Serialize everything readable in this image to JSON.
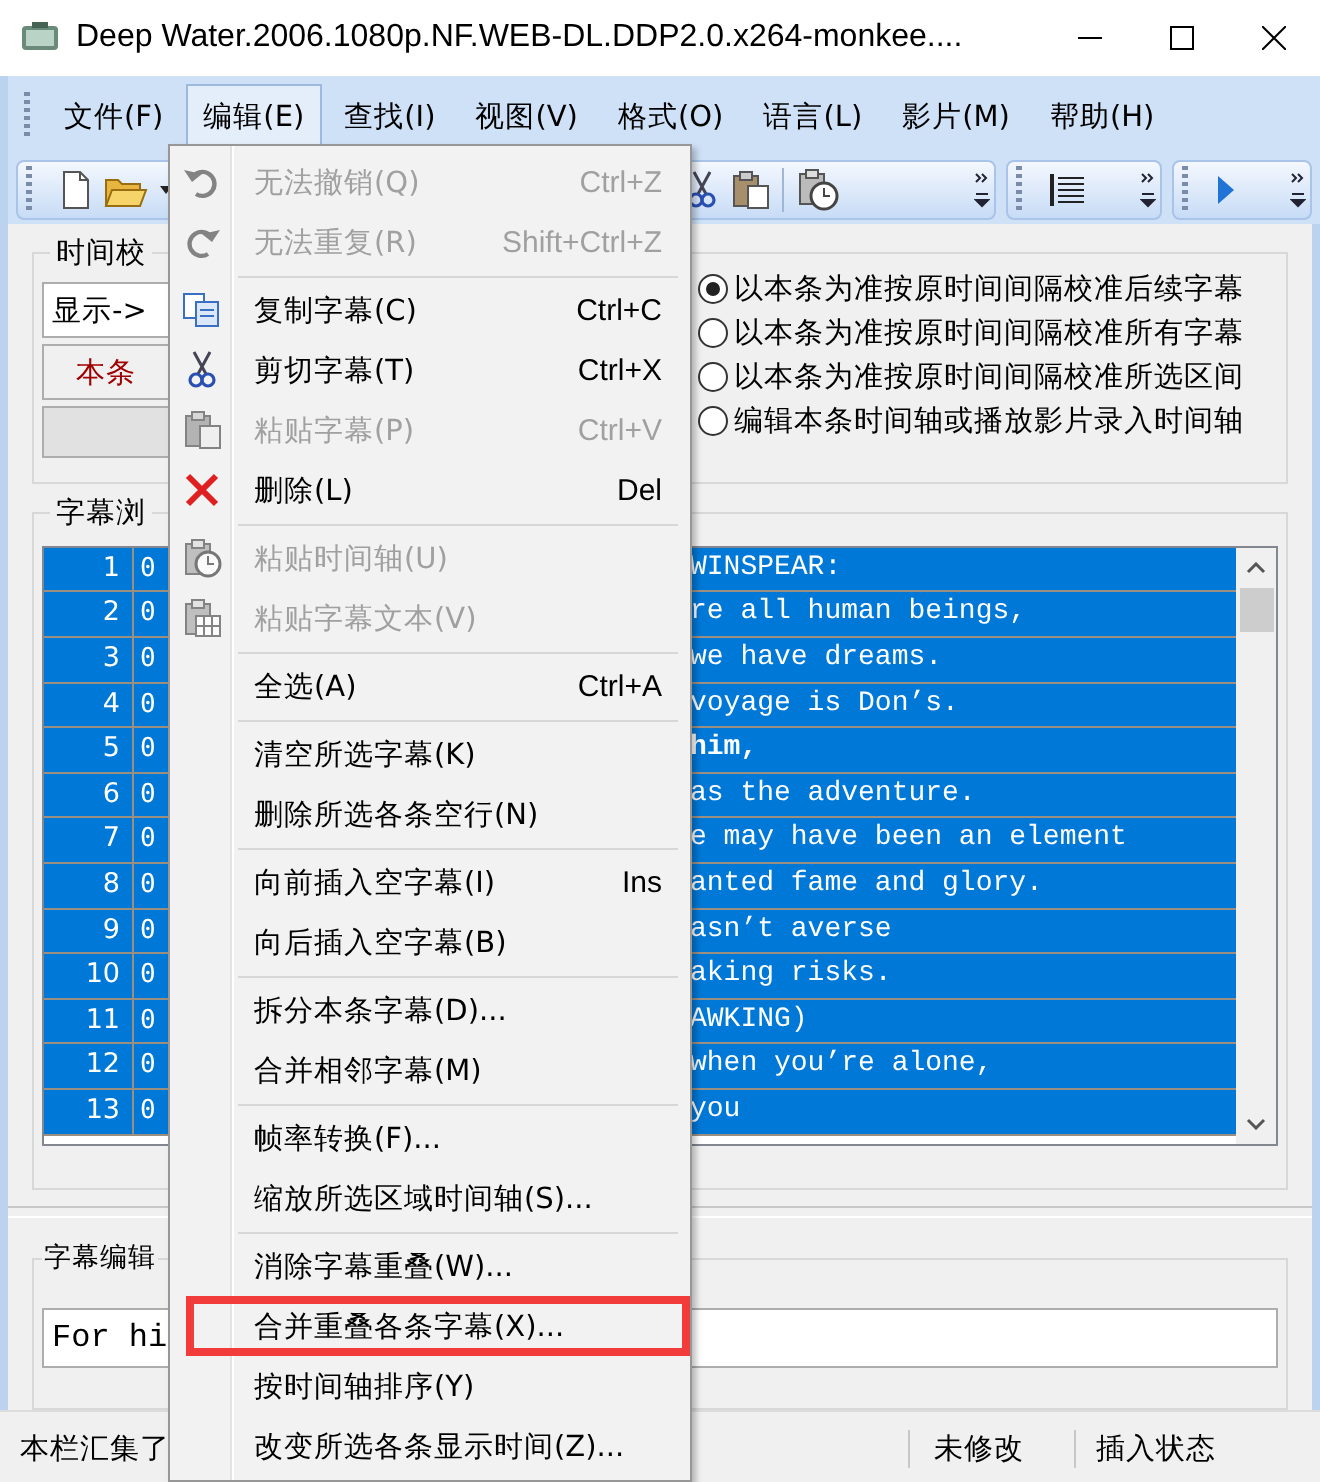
{
  "window": {
    "title": "Deep Water.2006.1080p.NF.WEB-DL.DDP2.0.x264-monkee...."
  },
  "menubar": [
    {
      "label": "文件(F)",
      "selected": false
    },
    {
      "label": "编辑(E)",
      "selected": true
    },
    {
      "label": "查找(I)",
      "selected": false
    },
    {
      "label": "视图(V)",
      "selected": false
    },
    {
      "label": "格式(O)",
      "selected": false
    },
    {
      "label": "语言(L)",
      "selected": false
    },
    {
      "label": "影片(M)",
      "selected": false
    },
    {
      "label": "帮助(H)",
      "selected": false
    }
  ],
  "time_group": {
    "title": "时间校",
    "display_label": "显示->",
    "red_button": "本条",
    "radios": [
      {
        "label": "以本条为准按原时间间隔校准后续字幕",
        "selected": true
      },
      {
        "label": "以本条为准按原时间间隔校准所有字幕",
        "selected": false
      },
      {
        "label": "以本条为准按原时间间隔校准所选区间",
        "selected": false
      },
      {
        "label": "编辑本条时间轴或播放影片录入时间轴",
        "selected": false
      }
    ]
  },
  "list_group": {
    "title": "字幕浏",
    "rows": [
      {
        "number": "1",
        "column_2": "0",
        "text": "WINSPEAR:",
        "bold": false,
        "selected": true
      },
      {
        "number": "2",
        "column_2": "0",
        "text": "re all human beings,",
        "bold": false,
        "selected": true
      },
      {
        "number": "3",
        "column_2": "0",
        "text": "we have dreams.",
        "bold": false,
        "selected": true
      },
      {
        "number": "4",
        "column_2": "0",
        "text": "voyage is Don’s.",
        "bold": false,
        "selected": true
      },
      {
        "number": "5",
        "column_2": "0",
        "text": "him,",
        "bold": true,
        "selected": true
      },
      {
        "number": "6",
        "column_2": "0",
        "text": "as the adventure.",
        "bold": false,
        "selected": true
      },
      {
        "number": "7",
        "column_2": "0",
        "text": "e may have been an element",
        "bold": false,
        "selected": true
      },
      {
        "number": "8",
        "column_2": "0",
        "text": "anted fame and glory.",
        "bold": false,
        "selected": true
      },
      {
        "number": "9",
        "column_2": "0",
        "text": "asn’t averse",
        "bold": false,
        "selected": true
      },
      {
        "number": "10",
        "column_2": "0",
        "text": "aking risks.",
        "bold": false,
        "selected": true
      },
      {
        "number": "11",
        "column_2": "0",
        "text": "AWKING)",
        "bold": false,
        "selected": true
      },
      {
        "number": "12",
        "column_2": "0",
        "text": "when you’re alone,",
        "bold": false,
        "selected": true
      },
      {
        "number": "13",
        "column_2": "0",
        "text": "you",
        "bold": false,
        "selected": true
      }
    ]
  },
  "editor_group": {
    "title": "字幕编辑",
    "value": "For hi"
  },
  "status_bar": [
    "本栏汇集了",
    "未修改",
    "插入状态"
  ],
  "menu": [
    {
      "kind": "item",
      "label": "无法撤销(Q)",
      "shortcut": "Ctrl+Z",
      "disabled": true,
      "highlighted": false
    },
    {
      "kind": "item",
      "label": "无法重复(R)",
      "shortcut": "Shift+Ctrl+Z",
      "disabled": true,
      "highlighted": false
    },
    {
      "kind": "separator"
    },
    {
      "kind": "item",
      "label": "复制字幕(C)",
      "shortcut": "Ctrl+C",
      "disabled": false,
      "highlighted": false
    },
    {
      "kind": "item",
      "label": "剪切字幕(T)",
      "shortcut": "Ctrl+X",
      "disabled": false,
      "highlighted": false
    },
    {
      "kind": "item",
      "label": "粘贴字幕(P)",
      "shortcut": "Ctrl+V",
      "disabled": true,
      "highlighted": false
    },
    {
      "kind": "item",
      "label": "删除(L)",
      "shortcut": "Del",
      "disabled": false,
      "highlighted": false
    },
    {
      "kind": "separator"
    },
    {
      "kind": "item",
      "label": "粘贴时间轴(U)",
      "disabled": true,
      "highlighted": false
    },
    {
      "kind": "item",
      "label": "粘贴字幕文本(V)",
      "disabled": true,
      "highlighted": false
    },
    {
      "kind": "separator"
    },
    {
      "kind": "item",
      "label": "全选(A)",
      "shortcut": "Ctrl+A",
      "disabled": false,
      "highlighted": false
    },
    {
      "kind": "separator"
    },
    {
      "kind": "item",
      "label": "清空所选字幕(K)",
      "disabled": false,
      "highlighted": false
    },
    {
      "kind": "item",
      "label": "删除所选各条空行(N)",
      "disabled": false,
      "highlighted": false
    },
    {
      "kind": "separator"
    },
    {
      "kind": "item",
      "label": "向前插入空字幕(I)",
      "shortcut": "Ins",
      "disabled": false,
      "highlighted": false
    },
    {
      "kind": "item",
      "label": "向后插入空字幕(B)",
      "disabled": false,
      "highlighted": false
    },
    {
      "kind": "separator"
    },
    {
      "kind": "item",
      "label": "拆分本条字幕(D)...",
      "disabled": false,
      "highlighted": false
    },
    {
      "kind": "item",
      "label": "合并相邻字幕(M)",
      "disabled": false,
      "highlighted": false
    },
    {
      "kind": "separator"
    },
    {
      "kind": "item",
      "label": "帧率转换(F)...",
      "disabled": false,
      "highlighted": false
    },
    {
      "kind": "item",
      "label": "缩放所选区域时间轴(S)...",
      "disabled": false,
      "highlighted": false
    },
    {
      "kind": "separator"
    },
    {
      "kind": "item",
      "label": "消除字幕重叠(W)...",
      "disabled": false,
      "highlighted": false
    },
    {
      "kind": "item",
      "label": "合并重叠各条字幕(X)...",
      "disabled": false,
      "highlighted": true
    },
    {
      "kind": "item",
      "label": "按时间轴排序(Y)",
      "disabled": false,
      "highlighted": false
    },
    {
      "kind": "item",
      "label": "改变所选各条显示时间(Z)...",
      "disabled": false,
      "highlighted": false
    }
  ]
}
